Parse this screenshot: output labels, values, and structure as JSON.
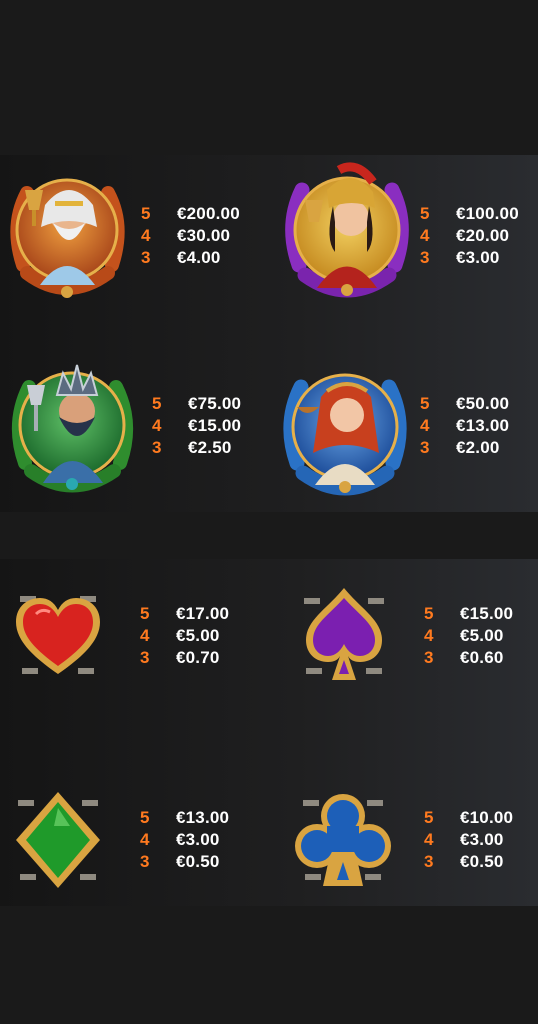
{
  "paytable": {
    "premium": [
      {
        "icon": "zeus-icon",
        "payouts": [
          {
            "count": "5",
            "amount": "€200.00"
          },
          {
            "count": "4",
            "amount": "€30.00"
          },
          {
            "count": "3",
            "amount": "€4.00"
          }
        ]
      },
      {
        "icon": "athena-icon",
        "payouts": [
          {
            "count": "5",
            "amount": "€100.00"
          },
          {
            "count": "4",
            "amount": "€20.00"
          },
          {
            "count": "3",
            "amount": "€3.00"
          }
        ]
      },
      {
        "icon": "poseidon-icon",
        "payouts": [
          {
            "count": "5",
            "amount": "€75.00"
          },
          {
            "count": "4",
            "amount": "€15.00"
          },
          {
            "count": "3",
            "amount": "€2.50"
          }
        ]
      },
      {
        "icon": "aphrodite-icon",
        "payouts": [
          {
            "count": "5",
            "amount": "€50.00"
          },
          {
            "count": "4",
            "amount": "€13.00"
          },
          {
            "count": "3",
            "amount": "€2.00"
          }
        ]
      }
    ],
    "low": [
      {
        "icon": "heart-icon",
        "payouts": [
          {
            "count": "5",
            "amount": "€17.00"
          },
          {
            "count": "4",
            "amount": "€5.00"
          },
          {
            "count": "3",
            "amount": "€0.70"
          }
        ]
      },
      {
        "icon": "spade-icon",
        "payouts": [
          {
            "count": "5",
            "amount": "€15.00"
          },
          {
            "count": "4",
            "amount": "€5.00"
          },
          {
            "count": "3",
            "amount": "€0.60"
          }
        ]
      },
      {
        "icon": "diamond-icon",
        "payouts": [
          {
            "count": "5",
            "amount": "€13.00"
          },
          {
            "count": "4",
            "amount": "€3.00"
          },
          {
            "count": "3",
            "amount": "€0.50"
          }
        ]
      },
      {
        "icon": "club-icon",
        "payouts": [
          {
            "count": "5",
            "amount": "€10.00"
          },
          {
            "count": "4",
            "amount": "€3.00"
          },
          {
            "count": "3",
            "amount": "€0.50"
          }
        ]
      }
    ]
  },
  "colors": {
    "count": "#ff7a1f",
    "amount": "#ffffff",
    "gold": "#d9a441",
    "heart": "#d8231f",
    "spade": "#7b1fb0",
    "diamond": "#1f9a2a",
    "club": "#1d5fb8"
  }
}
